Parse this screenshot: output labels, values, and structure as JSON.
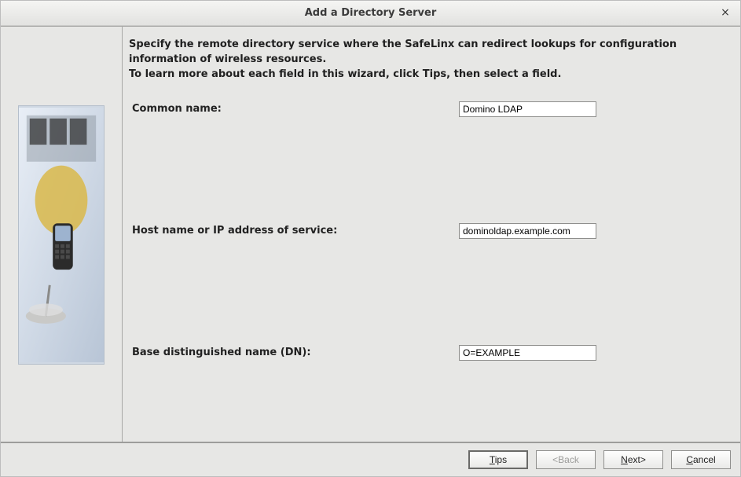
{
  "window": {
    "title": "Add a Directory Server"
  },
  "description_line1": "Specify the remote directory service where the SafeLinx can redirect lookups for configuration information of wireless resources.",
  "description_line2": "To learn more about each field in this wizard, click Tips, then select a field.",
  "fields": {
    "common_name": {
      "label": "Common name:",
      "value": "Domino LDAP"
    },
    "hostname": {
      "label": "Host name or IP address of service:",
      "value": "dominoldap.example.com"
    },
    "basedn": {
      "label": "Base distinguished name (DN):",
      "value": "O=EXAMPLE"
    }
  },
  "buttons": {
    "tips": "Tips",
    "back": "<Back",
    "next": "Next>",
    "cancel": "Cancel"
  },
  "icons": {
    "close": "×"
  }
}
